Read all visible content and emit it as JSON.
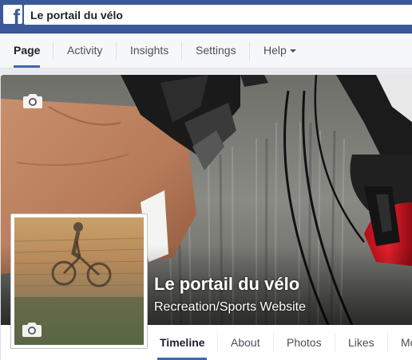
{
  "topbar": {
    "logo_letter": "f",
    "search_value": "Le portail du vélo"
  },
  "page_nav": {
    "tabs": [
      {
        "label": "Page"
      },
      {
        "label": "Activity"
      },
      {
        "label": "Insights"
      },
      {
        "label": "Settings"
      },
      {
        "label": "Help"
      }
    ],
    "active": "Page"
  },
  "cover": {
    "page_name": "Le portail du vélo",
    "category": "Recreation/Sports Website"
  },
  "timeline_tabs": {
    "tabs": [
      {
        "label": "Timeline"
      },
      {
        "label": "About"
      },
      {
        "label": "Photos"
      },
      {
        "label": "Likes"
      },
      {
        "label": "Mo"
      }
    ],
    "active": "Timeline"
  },
  "colors": {
    "brand_blue": "#3b5998",
    "tab_underline": "#4267b2"
  }
}
